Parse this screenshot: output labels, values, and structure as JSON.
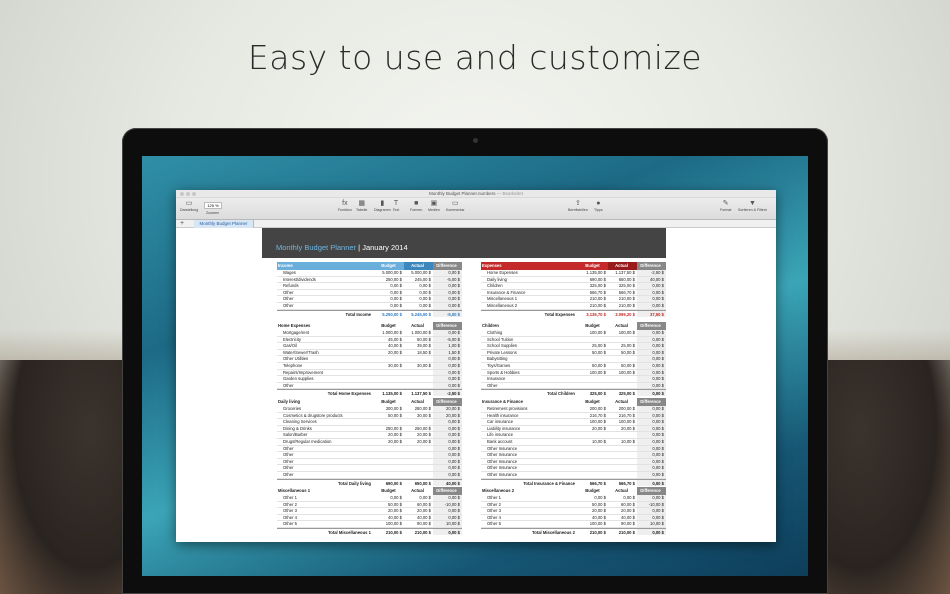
{
  "headline": "Easy to use and customize",
  "window": {
    "title": "Monthly Budget Planner.numbers",
    "title_suffix": "— Bearbeitet",
    "zoom": "125 %",
    "toolbar_left": [
      {
        "icon": "sidebar-icon",
        "label": "Darstellung"
      },
      {
        "icon": "zoom-icon",
        "label": "Zoomen"
      }
    ],
    "toolbar_center": [
      {
        "icon": "function-icon",
        "label": "Funktion",
        "glyph": "fx"
      },
      {
        "icon": "table-icon",
        "label": "Tabelle",
        "glyph": "▦"
      },
      {
        "icon": "chart-icon",
        "label": "Diagramm",
        "glyph": "▮"
      },
      {
        "icon": "text-icon",
        "label": "Text",
        "glyph": "T"
      },
      {
        "icon": "shape-icon",
        "label": "Formen",
        "glyph": "■"
      },
      {
        "icon": "media-icon",
        "label": "Medien",
        "glyph": "▣"
      },
      {
        "icon": "comment-icon",
        "label": "Kommentar",
        "glyph": "▭"
      }
    ],
    "toolbar_right": [
      {
        "icon": "share-icon",
        "label": "Bereitstellen",
        "glyph": "⇪"
      },
      {
        "icon": "tips-icon",
        "label": "Tipps",
        "glyph": "●"
      },
      {
        "icon": "format-icon",
        "label": "Format",
        "glyph": "✎"
      },
      {
        "icon": "filter-icon",
        "label": "Sortieren & Filtern",
        "glyph": "▼"
      }
    ],
    "sheet_tab": "Monthly Budget Planner",
    "add_sheet": "+"
  },
  "doc": {
    "title": "Monthly Budget Planner",
    "separator": " | ",
    "month": "January 2014"
  },
  "colors": {
    "income_header": "#6aaedc",
    "income_header_dark": "#3e87bd",
    "expenses_header": "#c42a2a",
    "expenses_header_dark": "#991b1b",
    "blue_total": "#2d7cc1",
    "red_total": "#c42a2a"
  },
  "tables": [
    {
      "id": "income",
      "name": "Income",
      "style": "income",
      "cols": [
        "Budget",
        "Actual",
        "Difference"
      ],
      "rows": [
        [
          "Wages",
          "5.000,00 $",
          "5.000,00 $",
          "0,00 $"
        ],
        [
          "Interest/dividends",
          "250,00 $",
          "245,00 $",
          "-5,00 $"
        ],
        [
          "Refunds",
          "0,00 $",
          "0,00 $",
          "0,00 $"
        ],
        [
          "Other",
          "0,00 $",
          "0,00 $",
          "0,00 $"
        ],
        [
          "Other",
          "0,00 $",
          "0,00 $",
          "0,00 $"
        ],
        [
          "Other",
          "0,00 $",
          "0,00 $",
          "0,00 $"
        ]
      ],
      "total": [
        "Total Income",
        "5.250,00 $",
        "5.245,00 $",
        "-5,00 $"
      ]
    },
    {
      "id": "expenses",
      "name": "Expenses",
      "style": "expenses",
      "cols": [
        "Budget",
        "Actual",
        "Difference"
      ],
      "rows": [
        [
          "Home Expenses",
          "1.135,00 $",
          "1.137,50 $",
          "-2,50 $"
        ],
        [
          "Daily living",
          "690,00 $",
          "650,00 $",
          "40,00 $"
        ],
        [
          "Children",
          "325,00 $",
          "325,00 $",
          "0,00 $"
        ],
        [
          "Insurance & Finance",
          "566,70 $",
          "566,70 $",
          "0,00 $"
        ],
        [
          "Miscellaneous 1",
          "210,00 $",
          "210,00 $",
          "0,00 $"
        ],
        [
          "Miscellaneous 2",
          "210,00 $",
          "210,00 $",
          "0,00 $"
        ]
      ],
      "total": [
        "Total Expenses",
        "3.136,70 $",
        "3.099,20 $",
        "37,50 $"
      ]
    },
    {
      "id": "home",
      "name": "Home Expenses",
      "style": "plain",
      "cols": [
        "Budget",
        "Actual",
        "Difference"
      ],
      "rows": [
        [
          "Mortgage/rent",
          "1.000,00 $",
          "1.000,00 $",
          "0,00 $"
        ],
        [
          "Electricity",
          "45,00 $",
          "50,00 $",
          "-5,00 $"
        ],
        [
          "Gas/Oil",
          "40,00 $",
          "39,00 $",
          "1,00 $"
        ],
        [
          "Water/Sewer/Trash",
          "20,00 $",
          "18,50 $",
          "1,50 $"
        ],
        [
          "Other Utilities",
          "",
          "",
          "0,00 $"
        ],
        [
          "Telephone",
          "30,00 $",
          "30,00 $",
          "0,00 $"
        ],
        [
          "Repairs/Improvement",
          "",
          "",
          "0,00 $"
        ],
        [
          "Garden supplies",
          "",
          "",
          "0,00 $"
        ],
        [
          "Other",
          "",
          "",
          "0,00 $"
        ]
      ],
      "total": [
        "Total Home Expenses",
        "1.135,00 $",
        "1.137,50 $",
        "-2,50 $"
      ]
    },
    {
      "id": "children",
      "name": "Children",
      "style": "plain",
      "cols": [
        "Budget",
        "Actual",
        "Difference"
      ],
      "rows": [
        [
          "Clothing",
          "100,00 $",
          "100,00 $",
          "0,00 $"
        ],
        [
          "School Tuition",
          "",
          "",
          "0,00 $"
        ],
        [
          "School Supplies",
          "25,00 $",
          "25,00 $",
          "0,00 $"
        ],
        [
          "Private Lessons",
          "50,00 $",
          "50,00 $",
          "0,00 $"
        ],
        [
          "Babysitting",
          "",
          "",
          "0,00 $"
        ],
        [
          "Toys/Games",
          "50,00 $",
          "50,00 $",
          "0,00 $"
        ],
        [
          "Sports & Hobbies",
          "100,00 $",
          "100,00 $",
          "0,00 $"
        ],
        [
          "Insurance",
          "",
          "",
          "0,00 $"
        ],
        [
          "Other",
          "",
          "",
          "0,00 $"
        ]
      ],
      "total": [
        "Total Children",
        "325,00 $",
        "325,00 $",
        "0,00 $"
      ]
    },
    {
      "id": "daily",
      "name": "Daily living",
      "style": "plain",
      "cols": [
        "Budget",
        "Actual",
        "Difference"
      ],
      "rows": [
        [
          "Groceries",
          "300,00 $",
          "280,00 $",
          "20,00 $"
        ],
        [
          "Cosmetics & drugstore products",
          "50,00 $",
          "30,00 $",
          "20,00 $"
        ],
        [
          "Cleaning Services",
          "",
          "",
          "0,00 $"
        ],
        [
          "Dining & Drinks",
          "250,00 $",
          "250,00 $",
          "0,00 $"
        ],
        [
          "Salon/Barber",
          "20,00 $",
          "20,00 $",
          "0,00 $"
        ],
        [
          "Drugs/Regular medication",
          "20,00 $",
          "20,00 $",
          "0,00 $"
        ],
        [
          "Other",
          "",
          "",
          "0,00 $"
        ],
        [
          "Other",
          "",
          "",
          "0,00 $"
        ],
        [
          "Other",
          "",
          "",
          "0,00 $"
        ],
        [
          "Other",
          "",
          "",
          "0,00 $"
        ],
        [
          "Other",
          "",
          "",
          "0,00 $"
        ]
      ],
      "total": [
        "Total Daily living",
        "690,00 $",
        "650,00 $",
        "40,00 $"
      ]
    },
    {
      "id": "insurance",
      "name": "Insurance & Finance",
      "style": "plain",
      "cols": [
        "Budget",
        "Actual",
        "Difference"
      ],
      "rows": [
        [
          "Retirement provisions",
          "200,00 $",
          "200,00 $",
          "0,00 $"
        ],
        [
          "Health insurance",
          "216,70 $",
          "216,70 $",
          "0,00 $"
        ],
        [
          "Car insurance",
          "100,00 $",
          "100,00 $",
          "0,00 $"
        ],
        [
          "Liability insurance",
          "20,00 $",
          "20,00 $",
          "0,00 $"
        ],
        [
          "Life insurance",
          "",
          "",
          "0,00 $"
        ],
        [
          "Bank account",
          "10,00 $",
          "10,00 $",
          "0,00 $"
        ],
        [
          "Other Insurance",
          "",
          "",
          "0,00 $"
        ],
        [
          "Other Insurance",
          "",
          "",
          "0,00 $"
        ],
        [
          "Other Insurance",
          "",
          "",
          "0,00 $"
        ],
        [
          "Other Insurance",
          "",
          "",
          "0,00 $"
        ],
        [
          "Other Insurance",
          "",
          "",
          "0,00 $"
        ]
      ],
      "total": [
        "Total Insurance & Finance",
        "566,70 $",
        "566,70 $",
        "0,00 $"
      ]
    },
    {
      "id": "misc1",
      "name": "Miscellaneous 1",
      "style": "plain",
      "cols": [
        "Budget",
        "Actual",
        "Difference"
      ],
      "rows": [
        [
          "Other 1",
          "0,00 $",
          "0,00 $",
          "0,00 $"
        ],
        [
          "Other 2",
          "50,00 $",
          "60,00 $",
          "-10,00 $"
        ],
        [
          "Other 3",
          "20,00 $",
          "20,00 $",
          "0,00 $"
        ],
        [
          "Other 4",
          "40,00 $",
          "40,00 $",
          "0,00 $"
        ],
        [
          "Other 5",
          "100,00 $",
          "90,00 $",
          "10,00 $"
        ]
      ],
      "total": [
        "Total Miscellaneous 1",
        "210,00 $",
        "210,00 $",
        "0,00 $"
      ]
    },
    {
      "id": "misc2",
      "name": "Miscellaneous 2",
      "style": "plain",
      "cols": [
        "Budget",
        "Actual",
        "Difference"
      ],
      "rows": [
        [
          "Other 1",
          "0,00 $",
          "0,00 $",
          "0,00 $"
        ],
        [
          "Other 2",
          "50,00 $",
          "60,00 $",
          "-10,00 $"
        ],
        [
          "Other 3",
          "20,00 $",
          "20,00 $",
          "0,00 $"
        ],
        [
          "Other 4",
          "40,00 $",
          "40,00 $",
          "0,00 $"
        ],
        [
          "Other 5",
          "100,00 $",
          "90,00 $",
          "10,00 $"
        ]
      ],
      "total": [
        "Total Miscellaneous 2",
        "210,00 $",
        "210,00 $",
        "0,00 $"
      ]
    }
  ]
}
